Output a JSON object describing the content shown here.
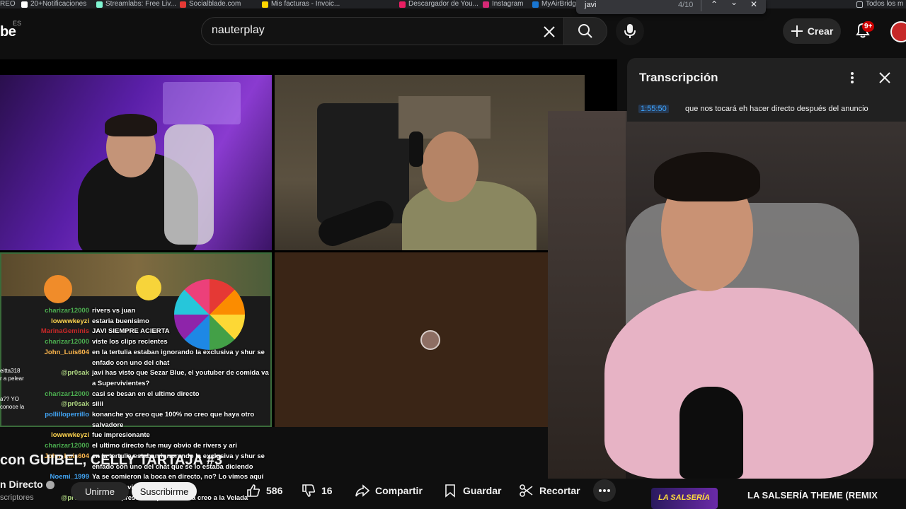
{
  "bookmarks": [
    {
      "label": "REO",
      "color": "#888888"
    },
    {
      "label": "20+Notificaciones",
      "color": "#ffffff"
    },
    {
      "label": "Streamlabs: Free Liv...",
      "color": "#80f5d2"
    },
    {
      "label": "Socialblade.com",
      "color": "#e53935"
    },
    {
      "label": "Mis facturas - Invoic...",
      "color": "#ffd600"
    },
    {
      "label": "Descargador de You...",
      "color": "#e91e63"
    },
    {
      "label": "Instagram",
      "color": "#d62976"
    },
    {
      "label": "MyAirBridge",
      "color": "#1976d2"
    },
    {
      "label": "Todos los m",
      "color": "#bdc1c6"
    }
  ],
  "find": {
    "query": "javi",
    "count": "4/10"
  },
  "masthead": {
    "logo": "be",
    "region": "ES",
    "search_value": "nauterplay",
    "create_label": "Crear",
    "notification_badge": "9+"
  },
  "chat": [
    {
      "user": "charizar12000",
      "color": "#4caf50",
      "msg": "rivers vs juan"
    },
    {
      "user": "lowwwkeyzi",
      "color": "#ffd54f",
      "msg": "estaria buenisimo"
    },
    {
      "user": "MarinaGeminis",
      "color": "#c62828",
      "msg": "JAVI SIEMPRE ACIERTA"
    },
    {
      "user": "charizar12000",
      "color": "#4caf50",
      "msg": "viste los clips recientes"
    },
    {
      "user": "John_Luis604",
      "color": "#ffb74d",
      "msg": "en la tertulia estaban ignorando la exclusiva y shur se enfado con uno del chat"
    },
    {
      "user": "@pr0sak",
      "color": "#aed581",
      "msg": "javi has visto que Sezar Blue, el youtuber de comida va a Supervivientes?"
    },
    {
      "user": "charizar12000",
      "color": "#4caf50",
      "msg": "casi se besan en el ultimo directo"
    },
    {
      "user": "@pr0sak",
      "color": "#aed581",
      "msg": "siiii"
    },
    {
      "user": "pollilloperrillo",
      "color": "#42a5f5",
      "msg": "konanche yo creo que 100% no creo que haya otro salvadore"
    },
    {
      "user": "lowwwkeyzi",
      "color": "#ffd54f",
      "msg": "fue impresionante"
    },
    {
      "user": "charizar12000",
      "color": "#4caf50",
      "msg": "el ultimo directo fue muy obvio de rivers y ari"
    },
    {
      "user": "John_Luis604",
      "color": "#ffb74d",
      "msg": "en la tertulia estaban ignorando la exclusiva y shur se enfado con uno del chat que se lo estaba diciendo"
    },
    {
      "user": "Noemi_1999",
      "color": "#42a5f5",
      "msg": "Ya se comieron la boca en directo, no? Lo vimos aquí contigo, Javi"
    },
    {
      "user": "@pr0sak",
      "color": "#aed581",
      "msg": "Sezar se presenta a peso mosca creo a la Velada"
    }
  ],
  "side_chat": [
    "eitta318",
    "r a pelear",
    "a?? YO",
    "conoce la"
  ],
  "video": {
    "title": "con GUIBEL, CELLY TARTAJA #3",
    "channel": "n Directo",
    "subscribers": "scriptores",
    "join_label": "Unirme",
    "subscribe_label": "Suscribirme"
  },
  "actions": {
    "likes": "586",
    "dislikes": "16",
    "share": "Compartir",
    "save": "Guardar",
    "clip": "Recortar"
  },
  "transcript": {
    "title": "Transcripción",
    "timestamp": "1:55:50",
    "text": "que nos tocará eh hacer directo después del anuncio"
  },
  "recommendation": {
    "thumb_text": "LA SALSERÍA",
    "title": "LA SALSERÍA THEME (REMIX"
  }
}
